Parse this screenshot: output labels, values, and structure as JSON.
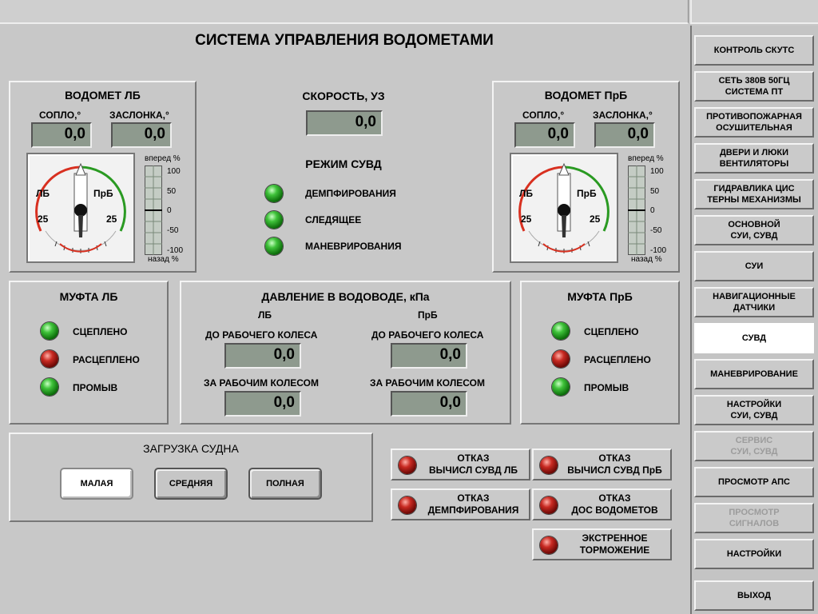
{
  "title": "СИСТЕМА УПРАВЛЕНИЯ ВОДОМЕТАМИ",
  "waterjet_lb": {
    "title": "ВОДОМЕТ ЛБ",
    "nozzle_label": "СОПЛО,°",
    "nozzle_value": "0,0",
    "flap_label": "ЗАСЛОНКА,°",
    "flap_value": "0,0",
    "gauge": {
      "left": "ЛБ",
      "right": "ПрБ",
      "left_num": "25",
      "right_num": "25"
    },
    "scale": {
      "top": "вперед %",
      "bottom": "назад %",
      "ticks": [
        "100",
        "50",
        "0",
        "-50",
        "-100"
      ]
    }
  },
  "waterjet_prb": {
    "title": "ВОДОМЕТ ПрБ",
    "nozzle_label": "СОПЛО,°",
    "nozzle_value": "0,0",
    "flap_label": "ЗАСЛОНКА,°",
    "flap_value": "0,0",
    "gauge": {
      "left": "ЛБ",
      "right": "ПрБ",
      "left_num": "25",
      "right_num": "25"
    },
    "scale": {
      "top": "вперед %",
      "bottom": "назад %",
      "ticks": [
        "100",
        "50",
        "0",
        "-50",
        "-100"
      ]
    }
  },
  "speed": {
    "label": "СКОРОСТЬ, УЗ",
    "value": "0,0"
  },
  "mode": {
    "title": "РЕЖИМ СУВД",
    "items": [
      {
        "label": "ДЕМПФИРОВАНИЯ",
        "color": "#1fa01a"
      },
      {
        "label": "СЛЕДЯЩЕЕ",
        "color": "#1fa01a"
      },
      {
        "label": "МАНЕВРИРОВАНИЯ",
        "color": "#1fa01a"
      }
    ]
  },
  "clutch_lb": {
    "title": "МУФТА ЛБ",
    "items": [
      {
        "label": "СЦЕПЛЕНО",
        "state": "green"
      },
      {
        "label": "РАСЦЕПЛЕНО",
        "state": "red"
      },
      {
        "label": "ПРОМЫВ",
        "state": "green"
      }
    ]
  },
  "clutch_prb": {
    "title": "МУФТА ПрБ",
    "items": [
      {
        "label": "СЦЕПЛЕНО",
        "state": "green"
      },
      {
        "label": "РАСЦЕПЛЕНО",
        "state": "red"
      },
      {
        "label": "ПРОМЫВ",
        "state": "green"
      }
    ]
  },
  "pressure": {
    "title": "ДАВЛЕНИЕ В ВОДОВОДЕ, кПа",
    "lb": "ЛБ",
    "prb": "ПрБ",
    "before_label": "ДО РАБОЧЕГО КОЛЕСА",
    "after_label": "ЗА РАБОЧИМ КОЛЕСОМ",
    "lb_before": "0,0",
    "lb_after": "0,0",
    "prb_before": "0,0",
    "prb_after": "0,0"
  },
  "load": {
    "title": "ЗАГРУЗКА СУДНА",
    "buttons": [
      "МАЛАЯ",
      "СРЕДНЯЯ",
      "ПОЛНАЯ"
    ],
    "active": "МАЛАЯ"
  },
  "alarms": [
    "ОТКАЗ\nВЫЧИСЛ СУВД ЛБ",
    "ОТКАЗ\nВЫЧИСЛ СУВД ПрБ",
    "ОТКАЗ\nДЕМПФИРОВАНИЯ",
    "ОТКАЗ\nДОС ВОДОМЕТОВ",
    "ЭКСТРЕННОЕ\nТОРМОЖЕНИЕ"
  ],
  "sidebar": [
    {
      "label": "КОНТРОЛЬ СКУТС",
      "state": "normal"
    },
    {
      "label": "СЕТЬ 380В 50ГЦ\nСИСТЕМА ПТ",
      "state": "normal"
    },
    {
      "label": "ПРОТИВОПОЖАРНАЯ\nОСУШИТЕЛЬНАЯ",
      "state": "normal"
    },
    {
      "label": "ДВЕРИ И ЛЮКИ\nВЕНТИЛЯТОРЫ",
      "state": "normal"
    },
    {
      "label": "ГИДРАВЛИКА ЦИС\nТЕРНЫ МЕХАНИЗМЫ",
      "state": "normal"
    },
    {
      "label": "ОСНОВНОЙ\nСУИ, СУВД",
      "state": "normal"
    },
    {
      "label": "СУИ",
      "state": "normal"
    },
    {
      "label": "НАВИГАЦИОННЫЕ\nДАТЧИКИ",
      "state": "normal"
    },
    {
      "label": "СУВД",
      "state": "active"
    },
    {
      "label": "МАНЕВРИРОВАНИЕ",
      "state": "normal"
    },
    {
      "label": "НАСТРОЙКИ\nСУИ, СУВД",
      "state": "normal"
    },
    {
      "label": "СЕРВИС\nСУИ, СУВД",
      "state": "disabled"
    },
    {
      "label": "ПРОСМОТР АПС",
      "state": "normal"
    },
    {
      "label": "ПРОСМОТР\nСИГНАЛОВ",
      "state": "disabled"
    },
    {
      "label": "НАСТРОЙКИ",
      "state": "normal"
    },
    {
      "label": "ВЫХОД",
      "state": "normal"
    }
  ]
}
